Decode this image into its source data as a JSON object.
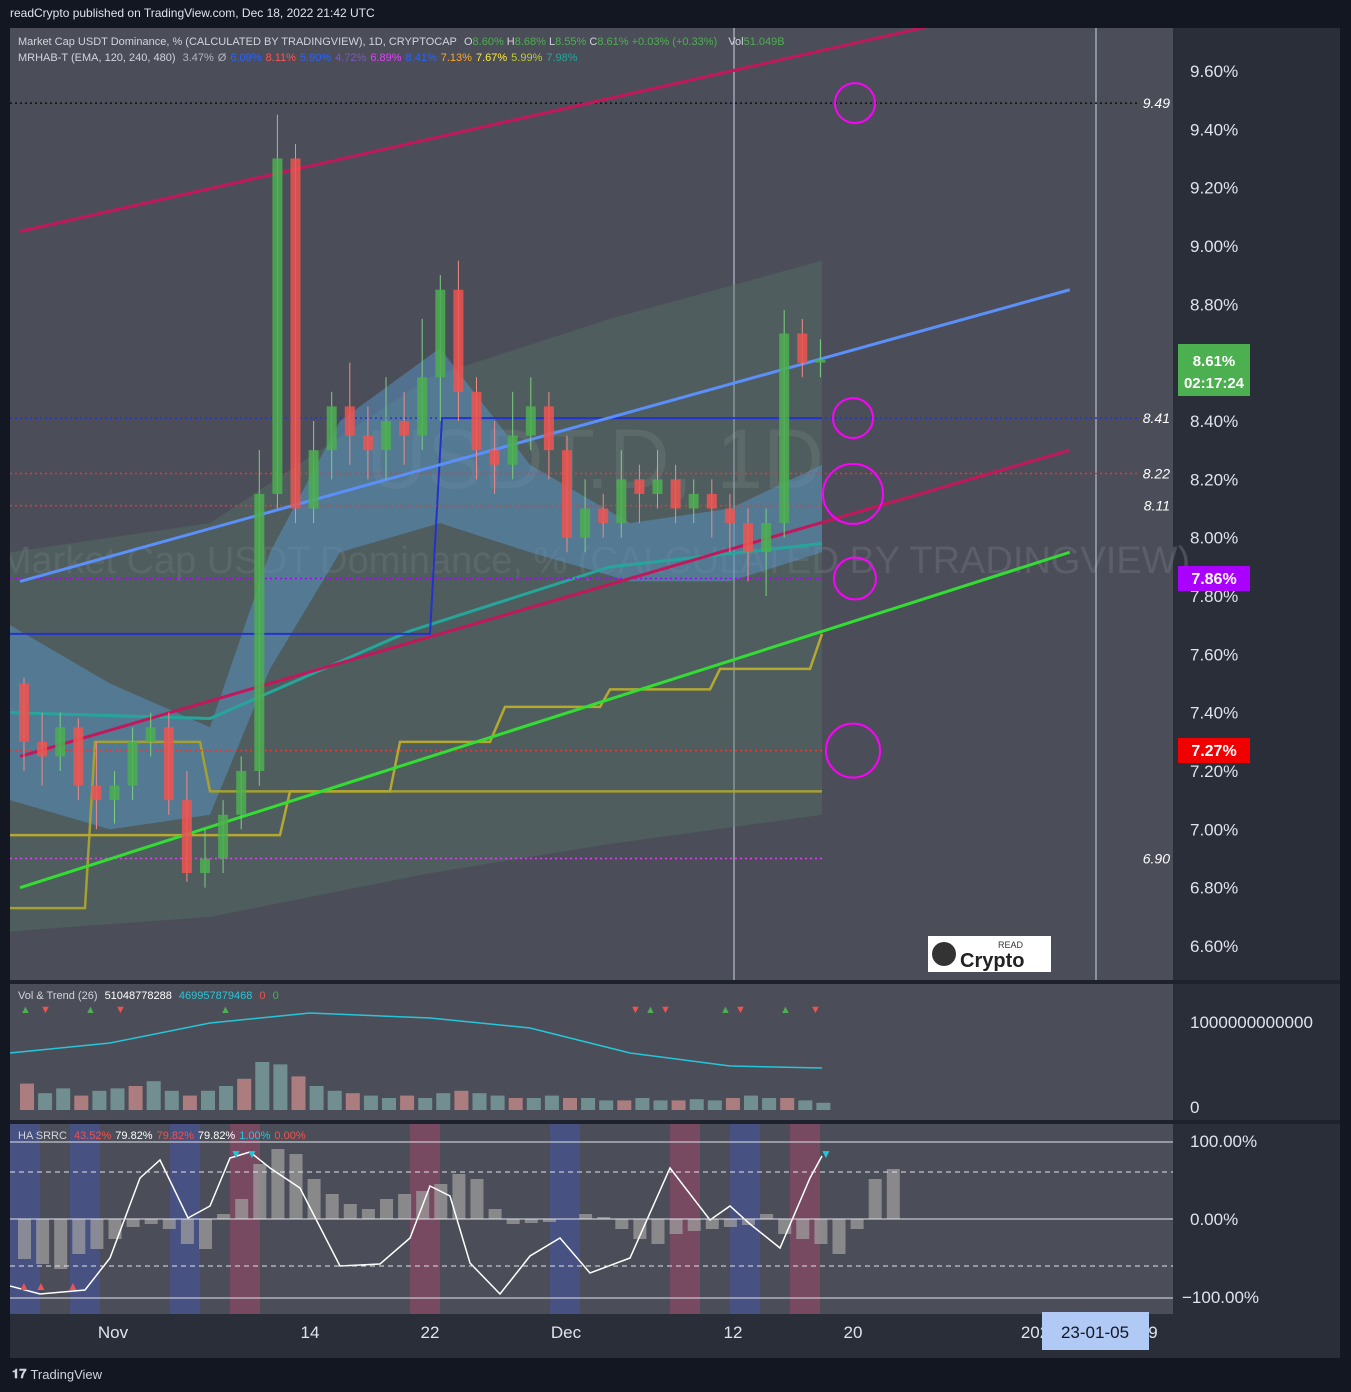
{
  "header": {
    "published": "readCrypto published on TradingView.com, Dec 18, 2022 21:42 UTC"
  },
  "legend_main": {
    "line1": {
      "title": "Market Cap USDT Dominance, % (CALCULATED BY TRADINGVIEW), 1D, CRYPTOCAP",
      "o_label": "O",
      "o": "8.60%",
      "h_label": "H",
      "h": "8.68%",
      "l_label": "L",
      "l": "8.55%",
      "c_label": "C",
      "c": "8.61%",
      "chg": "+0.03% (+0.33%)",
      "vol_label": "Vol",
      "vol": "51.049B"
    },
    "line2": {
      "name": "MRHAB-T (EMA, 120, 240, 480)",
      "values": [
        {
          "v": "3.47%",
          "color": "#b2b5be"
        },
        {
          "v": "Ø",
          "color": "#b2b5be"
        },
        {
          "v": "6.09%",
          "color": "#2962ff"
        },
        {
          "v": "8.11%",
          "color": "#ff5252"
        },
        {
          "v": "5.90%",
          "color": "#2962ff"
        },
        {
          "v": "4.72%",
          "color": "#7e57c2"
        },
        {
          "v": "6.89%",
          "color": "#e040fb"
        },
        {
          "v": "8.41%",
          "color": "#2962ff"
        },
        {
          "v": "7.13%",
          "color": "#ffa726"
        },
        {
          "v": "7.67%",
          "color": "#ffeb3b"
        },
        {
          "v": "5.99%",
          "color": "#c0ca33"
        },
        {
          "v": "7.98%",
          "color": "#26a69a"
        }
      ]
    }
  },
  "watermark": {
    "symbol": "USDT.D, 1D",
    "name": "Market Cap USDT Dominance, % (CALCULATED BY TRADINGVIEW)"
  },
  "logo": {
    "small": "READ",
    "big": "Crypto"
  },
  "price_axis": {
    "ticks": [
      "9.60%",
      "9.40%",
      "9.20%",
      "9.00%",
      "8.80%",
      "8.60%",
      "8.40%",
      "8.20%",
      "8.00%",
      "7.80%",
      "7.60%",
      "7.40%",
      "7.20%",
      "7.00%",
      "6.80%",
      "6.60%"
    ]
  },
  "price_tag": {
    "price": "8.61%",
    "countdown": "02:17:24",
    "color": "#4caf50"
  },
  "level_tags": [
    {
      "label": "7.86%",
      "color": "#aa00ff"
    },
    {
      "label": "7.27%",
      "color": "#f00000"
    }
  ],
  "level_labels": [
    "9.49",
    "8.41",
    "8.22",
    "8.11",
    "6.90"
  ],
  "time_axis": {
    "labels": [
      "Nov",
      "14",
      "22",
      "Dec",
      "12",
      "20",
      "202",
      "9"
    ],
    "cursor_label": "23-01-05"
  },
  "vol_panel": {
    "title": "Vol & Trend (26)",
    "v1": "51048778288",
    "v2": "469957879468",
    "v3": "0",
    "v4": "0",
    "axis_top": "1000000000000",
    "axis_bottom": "0"
  },
  "srrc_panel": {
    "title": "HA SRRC",
    "values": [
      {
        "v": "43.52%",
        "color": "#ef5350"
      },
      {
        "v": "79.82%",
        "color": "#ffffff"
      },
      {
        "v": "79.82%",
        "color": "#ef5350"
      },
      {
        "v": "79.82%",
        "color": "#ffffff"
      },
      {
        "v": "1.00%",
        "color": "#26c6da"
      },
      {
        "v": "0.00%",
        "color": "#ef5350"
      }
    ],
    "axis": [
      "100.00%",
      "0.00%",
      "−100.00%"
    ]
  },
  "footer": {
    "brand": "TradingView"
  },
  "chart_data": {
    "type": "candlestick",
    "title": "Market Cap USDT Dominance, % (CALCULATED BY TRADINGVIEW), 1D, CRYPTOCAP",
    "ylim": [
      6.5,
      9.75
    ],
    "candles": [
      [
        7.5,
        7.3,
        7.52,
        7.2
      ],
      [
        7.3,
        7.25,
        7.4,
        7.15
      ],
      [
        7.25,
        7.35,
        7.4,
        7.2
      ],
      [
        7.35,
        7.15,
        7.38,
        7.1
      ],
      [
        7.15,
        7.1,
        7.3,
        7.0
      ],
      [
        7.1,
        7.15,
        7.2,
        7.02
      ],
      [
        7.15,
        7.3,
        7.35,
        7.1
      ],
      [
        7.3,
        7.35,
        7.4,
        7.25
      ],
      [
        7.35,
        7.1,
        7.4,
        7.05
      ],
      [
        7.1,
        6.85,
        7.2,
        6.82
      ],
      [
        6.85,
        6.9,
        7.0,
        6.8
      ],
      [
        6.9,
        7.05,
        7.1,
        6.85
      ],
      [
        7.05,
        7.2,
        7.25,
        7.0
      ],
      [
        7.2,
        8.15,
        8.3,
        7.15
      ],
      [
        8.15,
        9.3,
        9.45,
        8.1
      ],
      [
        9.3,
        8.1,
        9.35,
        8.05
      ],
      [
        8.1,
        8.3,
        8.4,
        8.05
      ],
      [
        8.3,
        8.45,
        8.5,
        8.2
      ],
      [
        8.45,
        8.35,
        8.6,
        8.25
      ],
      [
        8.35,
        8.3,
        8.45,
        8.2
      ],
      [
        8.3,
        8.4,
        8.55,
        8.2
      ],
      [
        8.4,
        8.35,
        8.5,
        8.25
      ],
      [
        8.35,
        8.55,
        8.75,
        8.3
      ],
      [
        8.55,
        8.85,
        8.9,
        8.4
      ],
      [
        8.85,
        8.5,
        8.95,
        8.4
      ],
      [
        8.5,
        8.3,
        8.55,
        8.2
      ],
      [
        8.3,
        8.25,
        8.4,
        8.15
      ],
      [
        8.25,
        8.35,
        8.5,
        8.2
      ],
      [
        8.35,
        8.45,
        8.55,
        8.3
      ],
      [
        8.45,
        8.3,
        8.5,
        8.2
      ],
      [
        8.3,
        8.0,
        8.35,
        7.95
      ],
      [
        8.0,
        8.1,
        8.2,
        7.95
      ],
      [
        8.1,
        8.05,
        8.15,
        8.0
      ],
      [
        8.05,
        8.2,
        8.3,
        8.0
      ],
      [
        8.2,
        8.15,
        8.25,
        8.05
      ],
      [
        8.15,
        8.2,
        8.3,
        8.1
      ],
      [
        8.2,
        8.1,
        8.25,
        8.05
      ],
      [
        8.1,
        8.15,
        8.2,
        8.05
      ],
      [
        8.15,
        8.1,
        8.2,
        8.0
      ],
      [
        8.1,
        8.05,
        8.15,
        7.95
      ],
      [
        8.05,
        7.95,
        8.1,
        7.85
      ],
      [
        7.95,
        8.05,
        8.1,
        7.8
      ],
      [
        8.05,
        8.7,
        8.78,
        8.0
      ],
      [
        8.7,
        8.6,
        8.75,
        8.55
      ],
      [
        8.6,
        8.61,
        8.68,
        8.55
      ]
    ],
    "levels": [
      9.49,
      8.41,
      8.22,
      8.11,
      7.86,
      7.27,
      6.9
    ],
    "last_price": 8.61,
    "lines": [
      {
        "name": "blue trend",
        "color": "#5b8ff9",
        "from": [
          0,
          7.85
        ],
        "to": [
          58,
          8.85
        ]
      },
      {
        "name": "green trend",
        "color": "#33dd33",
        "from": [
          0,
          6.8
        ],
        "to": [
          58,
          7.95
        ]
      },
      {
        "name": "upper channel",
        "color": "#c2185b",
        "from": [
          0,
          9.05
        ],
        "to": [
          50,
          9.75
        ]
      },
      {
        "name": "lower channel",
        "color": "#c2185b",
        "from": [
          0,
          7.25
        ],
        "to": [
          58,
          8.3
        ]
      }
    ]
  }
}
